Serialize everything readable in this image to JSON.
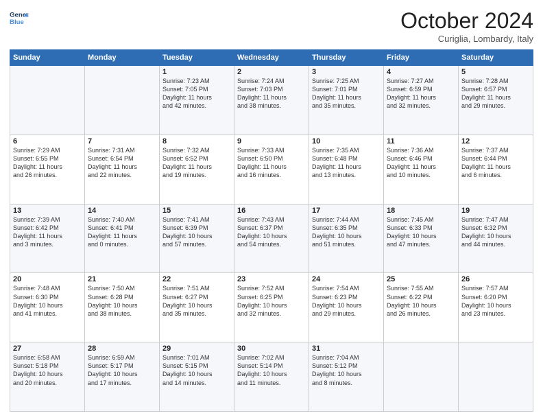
{
  "header": {
    "logo_line1": "General",
    "logo_line2": "Blue",
    "title": "October 2024",
    "subtitle": "Curiglia, Lombardy, Italy"
  },
  "days_of_week": [
    "Sunday",
    "Monday",
    "Tuesday",
    "Wednesday",
    "Thursday",
    "Friday",
    "Saturday"
  ],
  "weeks": [
    [
      {
        "day": "",
        "text": ""
      },
      {
        "day": "",
        "text": ""
      },
      {
        "day": "1",
        "text": "Sunrise: 7:23 AM\nSunset: 7:05 PM\nDaylight: 11 hours\nand 42 minutes."
      },
      {
        "day": "2",
        "text": "Sunrise: 7:24 AM\nSunset: 7:03 PM\nDaylight: 11 hours\nand 38 minutes."
      },
      {
        "day": "3",
        "text": "Sunrise: 7:25 AM\nSunset: 7:01 PM\nDaylight: 11 hours\nand 35 minutes."
      },
      {
        "day": "4",
        "text": "Sunrise: 7:27 AM\nSunset: 6:59 PM\nDaylight: 11 hours\nand 32 minutes."
      },
      {
        "day": "5",
        "text": "Sunrise: 7:28 AM\nSunset: 6:57 PM\nDaylight: 11 hours\nand 29 minutes."
      }
    ],
    [
      {
        "day": "6",
        "text": "Sunrise: 7:29 AM\nSunset: 6:55 PM\nDaylight: 11 hours\nand 26 minutes."
      },
      {
        "day": "7",
        "text": "Sunrise: 7:31 AM\nSunset: 6:54 PM\nDaylight: 11 hours\nand 22 minutes."
      },
      {
        "day": "8",
        "text": "Sunrise: 7:32 AM\nSunset: 6:52 PM\nDaylight: 11 hours\nand 19 minutes."
      },
      {
        "day": "9",
        "text": "Sunrise: 7:33 AM\nSunset: 6:50 PM\nDaylight: 11 hours\nand 16 minutes."
      },
      {
        "day": "10",
        "text": "Sunrise: 7:35 AM\nSunset: 6:48 PM\nDaylight: 11 hours\nand 13 minutes."
      },
      {
        "day": "11",
        "text": "Sunrise: 7:36 AM\nSunset: 6:46 PM\nDaylight: 11 hours\nand 10 minutes."
      },
      {
        "day": "12",
        "text": "Sunrise: 7:37 AM\nSunset: 6:44 PM\nDaylight: 11 hours\nand 6 minutes."
      }
    ],
    [
      {
        "day": "13",
        "text": "Sunrise: 7:39 AM\nSunset: 6:42 PM\nDaylight: 11 hours\nand 3 minutes."
      },
      {
        "day": "14",
        "text": "Sunrise: 7:40 AM\nSunset: 6:41 PM\nDaylight: 11 hours\nand 0 minutes."
      },
      {
        "day": "15",
        "text": "Sunrise: 7:41 AM\nSunset: 6:39 PM\nDaylight: 10 hours\nand 57 minutes."
      },
      {
        "day": "16",
        "text": "Sunrise: 7:43 AM\nSunset: 6:37 PM\nDaylight: 10 hours\nand 54 minutes."
      },
      {
        "day": "17",
        "text": "Sunrise: 7:44 AM\nSunset: 6:35 PM\nDaylight: 10 hours\nand 51 minutes."
      },
      {
        "day": "18",
        "text": "Sunrise: 7:45 AM\nSunset: 6:33 PM\nDaylight: 10 hours\nand 47 minutes."
      },
      {
        "day": "19",
        "text": "Sunrise: 7:47 AM\nSunset: 6:32 PM\nDaylight: 10 hours\nand 44 minutes."
      }
    ],
    [
      {
        "day": "20",
        "text": "Sunrise: 7:48 AM\nSunset: 6:30 PM\nDaylight: 10 hours\nand 41 minutes."
      },
      {
        "day": "21",
        "text": "Sunrise: 7:50 AM\nSunset: 6:28 PM\nDaylight: 10 hours\nand 38 minutes."
      },
      {
        "day": "22",
        "text": "Sunrise: 7:51 AM\nSunset: 6:27 PM\nDaylight: 10 hours\nand 35 minutes."
      },
      {
        "day": "23",
        "text": "Sunrise: 7:52 AM\nSunset: 6:25 PM\nDaylight: 10 hours\nand 32 minutes."
      },
      {
        "day": "24",
        "text": "Sunrise: 7:54 AM\nSunset: 6:23 PM\nDaylight: 10 hours\nand 29 minutes."
      },
      {
        "day": "25",
        "text": "Sunrise: 7:55 AM\nSunset: 6:22 PM\nDaylight: 10 hours\nand 26 minutes."
      },
      {
        "day": "26",
        "text": "Sunrise: 7:57 AM\nSunset: 6:20 PM\nDaylight: 10 hours\nand 23 minutes."
      }
    ],
    [
      {
        "day": "27",
        "text": "Sunrise: 6:58 AM\nSunset: 5:18 PM\nDaylight: 10 hours\nand 20 minutes."
      },
      {
        "day": "28",
        "text": "Sunrise: 6:59 AM\nSunset: 5:17 PM\nDaylight: 10 hours\nand 17 minutes."
      },
      {
        "day": "29",
        "text": "Sunrise: 7:01 AM\nSunset: 5:15 PM\nDaylight: 10 hours\nand 14 minutes."
      },
      {
        "day": "30",
        "text": "Sunrise: 7:02 AM\nSunset: 5:14 PM\nDaylight: 10 hours\nand 11 minutes."
      },
      {
        "day": "31",
        "text": "Sunrise: 7:04 AM\nSunset: 5:12 PM\nDaylight: 10 hours\nand 8 minutes."
      },
      {
        "day": "",
        "text": ""
      },
      {
        "day": "",
        "text": ""
      }
    ]
  ]
}
